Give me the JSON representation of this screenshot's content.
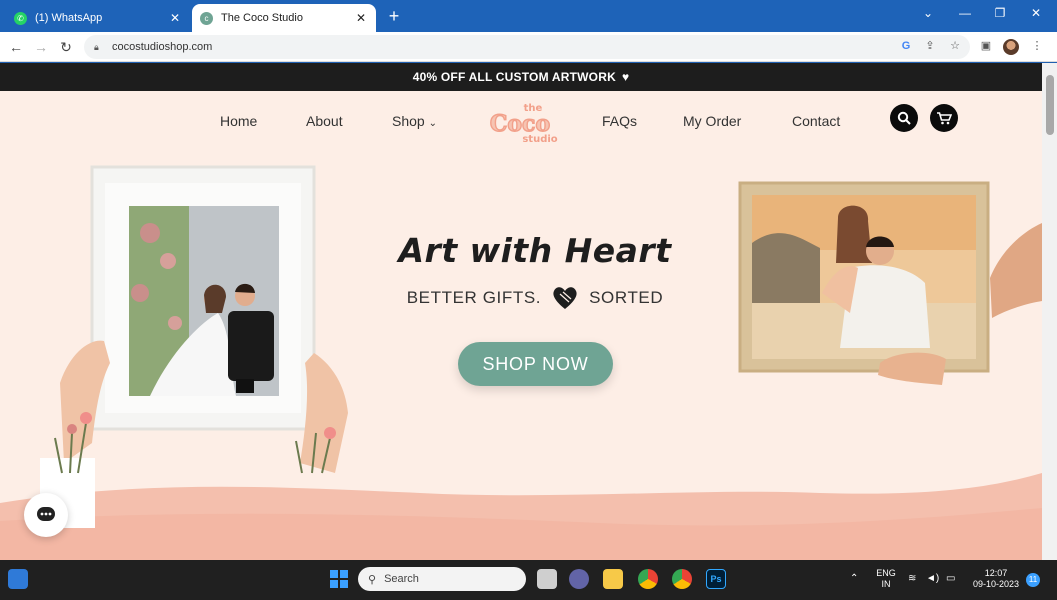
{
  "browser": {
    "tabs": [
      {
        "title": "(1) WhatsApp",
        "active": false,
        "color": "#25d366"
      },
      {
        "title": "The Coco Studio",
        "active": true,
        "color": "#6fa494"
      }
    ],
    "url": "cocostudioshop.com"
  },
  "site": {
    "announcement": "40% OFF ALL CUSTOM ARTWORK",
    "nav": [
      "Home",
      "About",
      "Shop",
      "FAQs",
      "My Order",
      "Contact"
    ],
    "logo": {
      "top": "the",
      "main": "Coco",
      "bottom": "studio"
    },
    "hero": {
      "title": "Art with Heart",
      "subtitle_left": "BETTER GIFTS.",
      "subtitle_right": "SORTED",
      "cta": "SHOP NOW"
    }
  },
  "taskbar": {
    "search_label": "Search",
    "lang": [
      "ENG",
      "IN"
    ],
    "time": "12:07",
    "date": "09-10-2023",
    "notification_count": "11"
  },
  "colors": {
    "chrome_blue": "#1e63b8",
    "page_bg": "#fdeee6",
    "wave": "#f4bfad",
    "cta": "#6fa494",
    "logo": "#f2a08a"
  }
}
